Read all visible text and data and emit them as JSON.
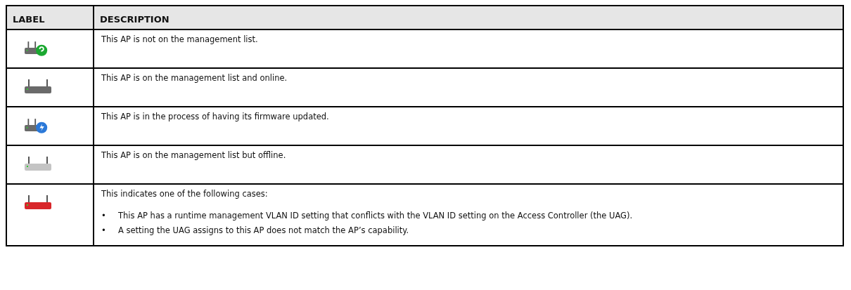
{
  "table": {
    "columns": [
      "LABEL",
      "DESCRIPTION"
    ],
    "rows": [
      {
        "kind": "unmanaged",
        "description": "This AP is not on the management list."
      },
      {
        "kind": "online",
        "description": "This AP is on the management list and online."
      },
      {
        "kind": "updating",
        "description": "This AP is in the process of having its firmware updated."
      },
      {
        "kind": "offline",
        "description": "This AP is on the management list but offline."
      },
      {
        "kind": "conflict",
        "description": "This indicates one of the following cases:",
        "bullets": [
          {
            "marker": "•",
            "text": "This AP has a runtime management VLAN ID setting that conflicts with the VLAN ID setting on the Access Controller (the UAG)."
          },
          {
            "marker": "•",
            "text": "A setting the UAG assigns to this AP does not match the AP’s capability."
          }
        ]
      }
    ]
  }
}
